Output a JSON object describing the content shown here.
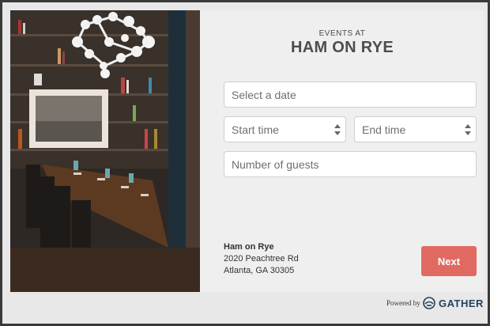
{
  "header": {
    "eyebrow": "EVENTS AT",
    "title": "HAM ON RYE"
  },
  "form": {
    "date_placeholder": "Select a date",
    "start_time_placeholder": "Start time",
    "end_time_placeholder": "End time",
    "guests_placeholder": "Number of guests"
  },
  "venue": {
    "name": "Ham on Rye",
    "address_line1": "2020 Peachtree Rd",
    "address_line2": "Atlanta, GA 30305"
  },
  "actions": {
    "next_label": "Next"
  },
  "footer": {
    "powered_by": "Powered by",
    "brand": "GATHER"
  },
  "colors": {
    "accent": "#e06a62",
    "brand": "#22415f",
    "panel_bg": "#efefef"
  },
  "icons": {
    "select_arrows": "updown-arrow-icon",
    "brand_logo": "gather-logo-icon"
  }
}
